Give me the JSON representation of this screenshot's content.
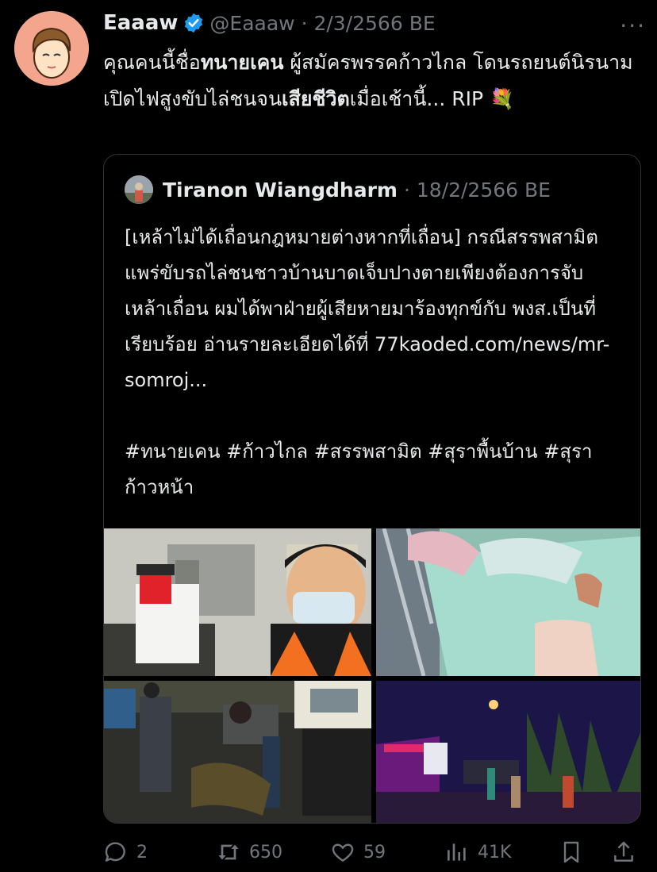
{
  "tweet": {
    "author": {
      "display_name": "Eaaaw",
      "handle_and_date": "@Eaaaw · 2/3/2566 BE",
      "verified": true
    },
    "text_parts": [
      "คุณคนนี้ชื่อ",
      "ทนายเคน",
      " ผู้สมัครพรรคก้าวไกล โดนรถยนต์นิรนามเปิดไฟสูงขับไล่ชนจน",
      "เสียชีวิต",
      "เมื่อเช้านี้... RIP 💐"
    ],
    "more_label": "···",
    "colors": {
      "accent": "#1d9bf0",
      "muted": "#71767b",
      "border": "#2f3336"
    }
  },
  "quote": {
    "author": "Tiranon Wiangdharm",
    "meta": "· 18/2/2566 BE",
    "text": "[เหล้าไม่ได้เถื่อนกฎหมายต่างหากที่เถื่อน] กรณีสรรพสามิตแพร่ขับรถไล่ชนชาวบ้านบาดเจ็บปางตายเพียงต้องการจับเหล้าเถื่อน ผมได้พาฝ่ายผู้เสียหายมาร้องทุกข์กับ พงส.เป็นที่เรียบร้อย อ่านรายละเอียดได้ที่ 77kaoded.com/news/mr-somroj...\n\n#ทนายเคน #ก้าวไกล #สรรพสามิต #สุราพื้นบ้าน #สุราก้าวหน้า"
  },
  "actions": {
    "reply": "2",
    "retweet": "650",
    "like": "59",
    "views": "41K",
    "icons": [
      "reply-icon",
      "retweet-icon",
      "like-icon",
      "views-icon",
      "bookmark-icon",
      "share-icon"
    ]
  }
}
